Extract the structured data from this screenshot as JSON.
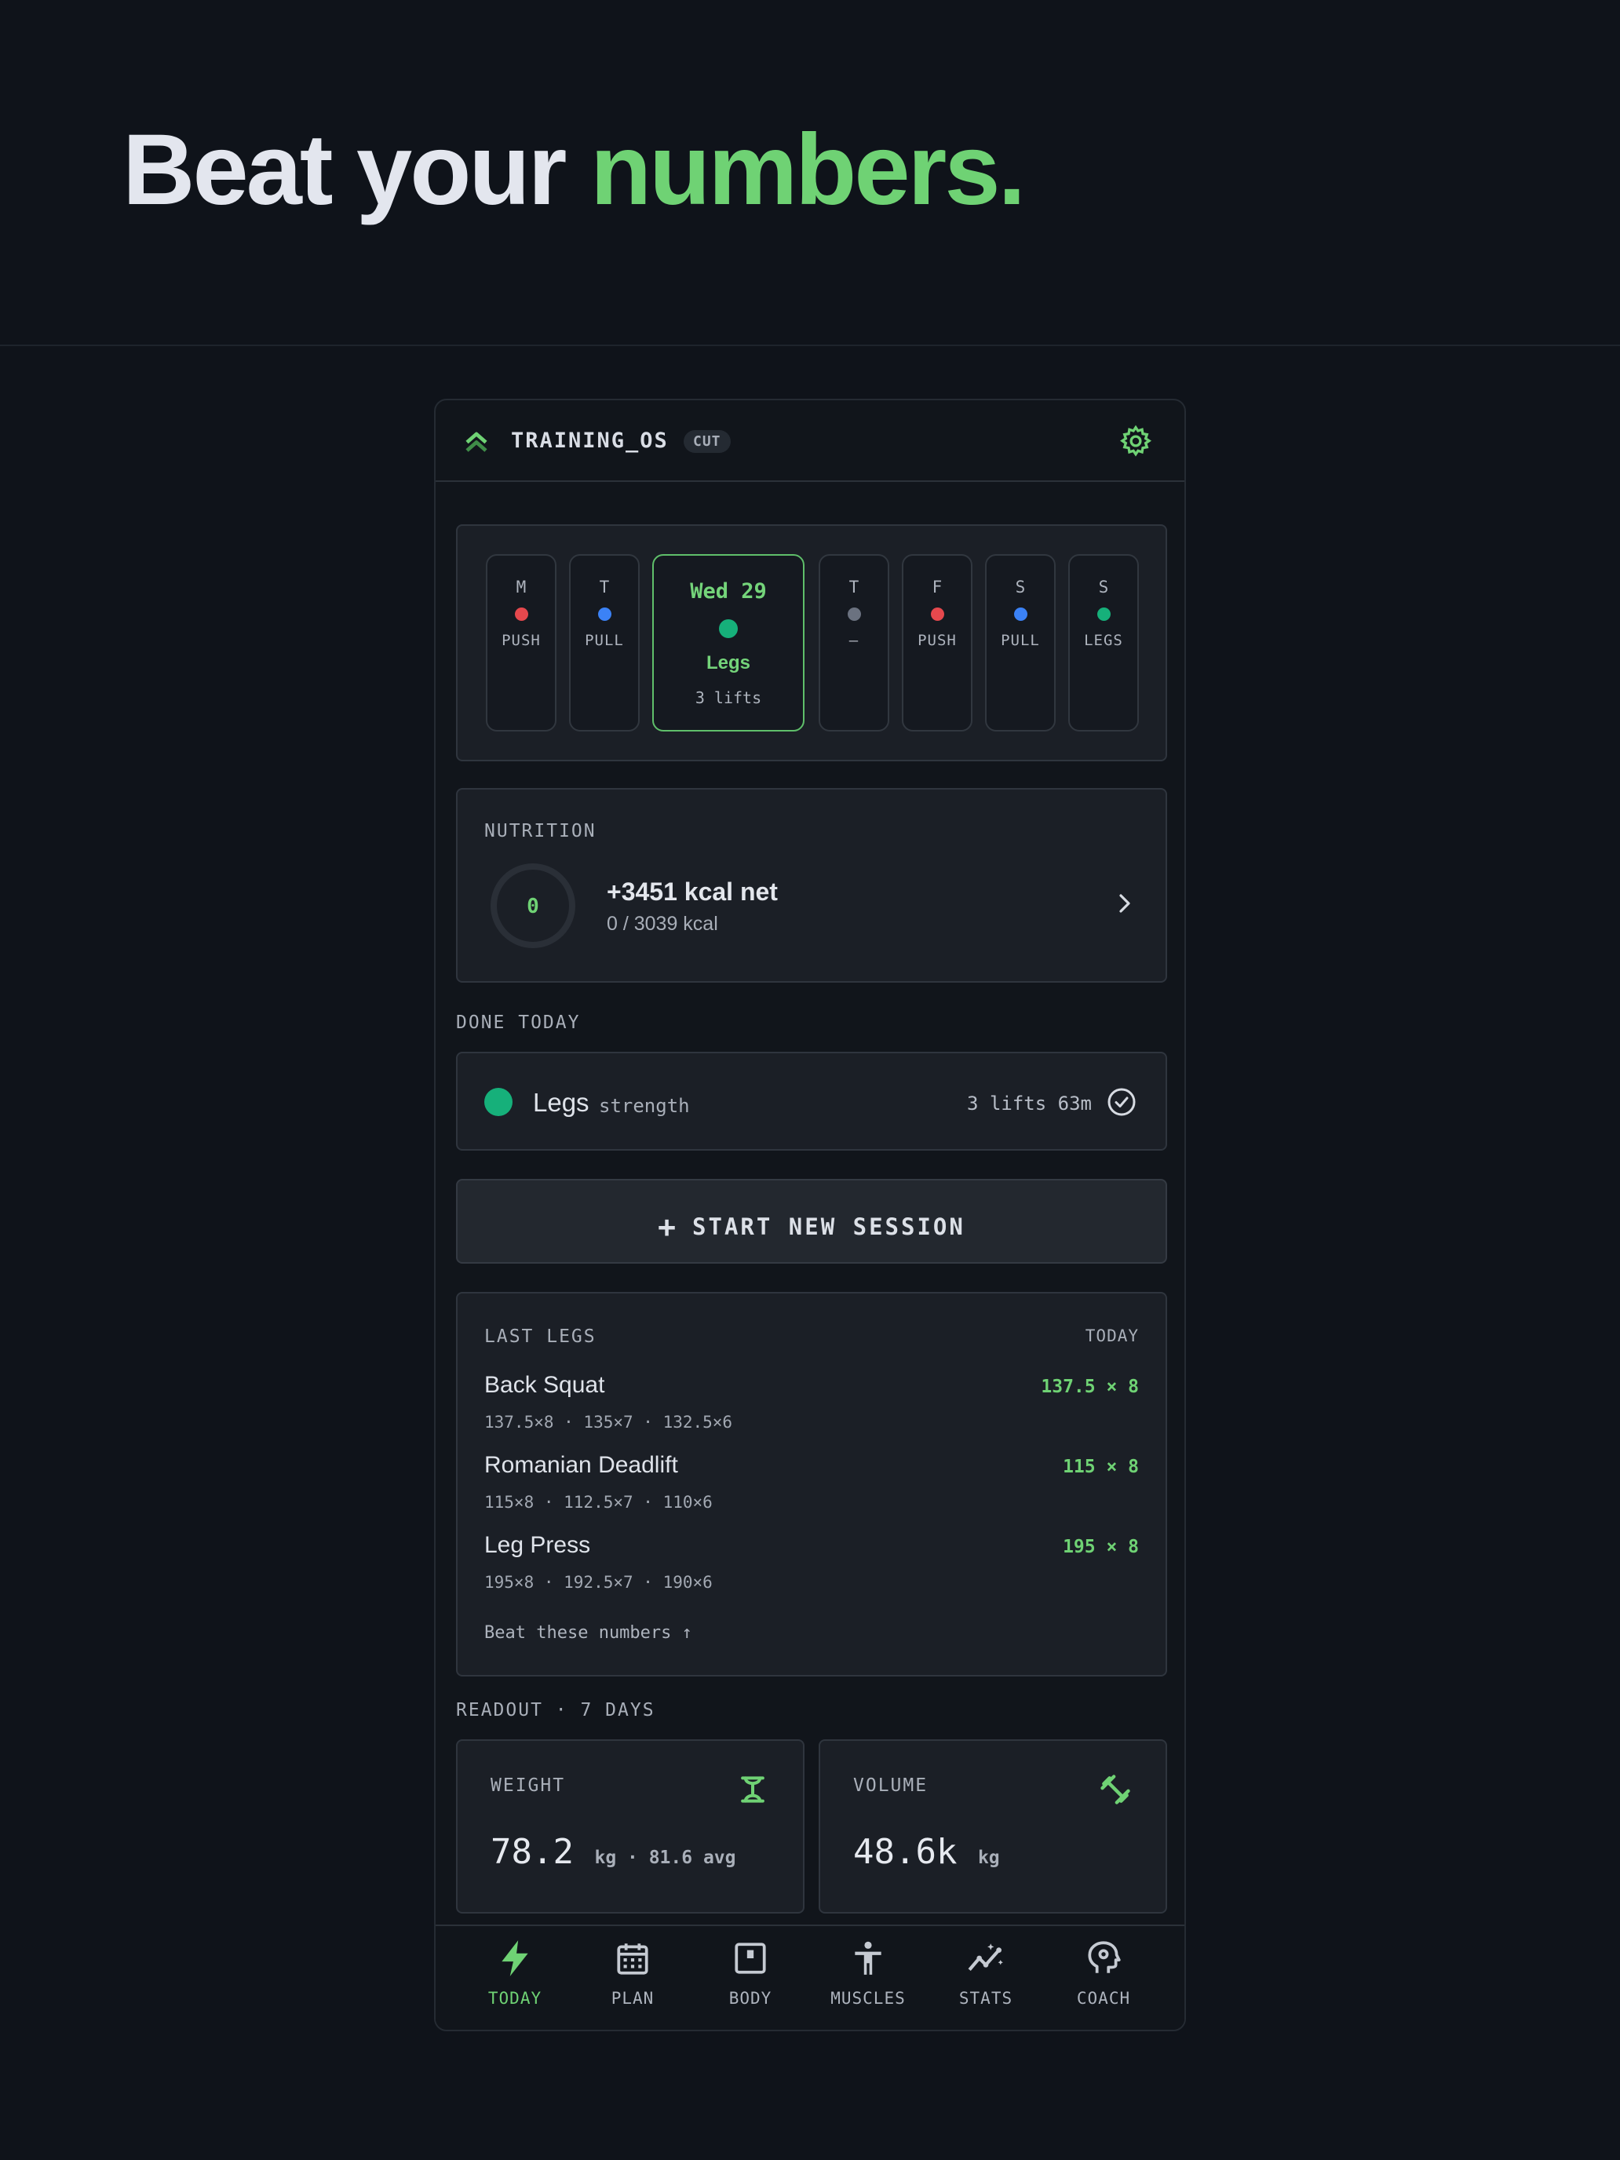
{
  "hero": {
    "title_white": "Beat your ",
    "title_green": "numbers."
  },
  "header": {
    "app_name": "TRAINING_OS",
    "mode_badge": "CUT"
  },
  "week": {
    "days": [
      {
        "letter": "M",
        "workout": "PUSH",
        "color": "#e5484d"
      },
      {
        "letter": "T",
        "workout": "PULL",
        "color": "#3b82f6"
      },
      {
        "letter": "Wed 29",
        "workout": "Legs",
        "lifts": "3 lifts",
        "color": "#16b07a",
        "active": true
      },
      {
        "letter": "T",
        "workout": "–",
        "color": "#6b7280"
      },
      {
        "letter": "F",
        "workout": "PUSH",
        "color": "#e5484d"
      },
      {
        "letter": "S",
        "workout": "PULL",
        "color": "#3b82f6"
      },
      {
        "letter": "S",
        "workout": "LEGS",
        "color": "#16b07a"
      }
    ]
  },
  "nutrition": {
    "label": "NUTRITION",
    "ring_value": "0",
    "net": "+3451 kcal net",
    "detail": "0 / 3039 kcal"
  },
  "done_today": {
    "label": "DONE TODAY",
    "name": "Legs",
    "type": "strength",
    "meta": "3 lifts 63m"
  },
  "start_session": {
    "label": "START NEW SESSION"
  },
  "last_session": {
    "title": "LAST LEGS",
    "when": "TODAY",
    "exercises": [
      {
        "name": "Back Squat",
        "best": "137.5 × 8",
        "sets": "137.5×8 · 135×7 · 132.5×6"
      },
      {
        "name": "Romanian Deadlift",
        "best": "115 × 8",
        "sets": "115×8 · 112.5×7 · 110×6"
      },
      {
        "name": "Leg Press",
        "best": "195 × 8",
        "sets": "195×8 · 192.5×7 · 190×6"
      }
    ],
    "cta": "Beat these numbers ↑"
  },
  "readout": {
    "label": "READOUT · 7 DAYS",
    "weight": {
      "label": "WEIGHT",
      "value": "78.2",
      "unit": "kg · 81.6 avg",
      "icon": "scale-icon"
    },
    "volume": {
      "label": "VOLUME",
      "value": "48.6k",
      "unit": "kg",
      "icon": "dumbbell-icon"
    }
  },
  "tabs": [
    {
      "label": "TODAY",
      "icon": "bolt-icon",
      "active": true
    },
    {
      "label": "PLAN",
      "icon": "calendar-icon"
    },
    {
      "label": "BODY",
      "icon": "scale-box-icon"
    },
    {
      "label": "MUSCLES",
      "icon": "figure-icon"
    },
    {
      "label": "STATS",
      "icon": "chart-icon"
    },
    {
      "label": "COACH",
      "icon": "coach-icon"
    }
  ],
  "colors": {
    "accent": "#6fd274",
    "background": "#0f131a",
    "card": "#1b1f26",
    "legs": "#16b07a",
    "push": "#e5484d",
    "pull": "#3b82f6"
  }
}
